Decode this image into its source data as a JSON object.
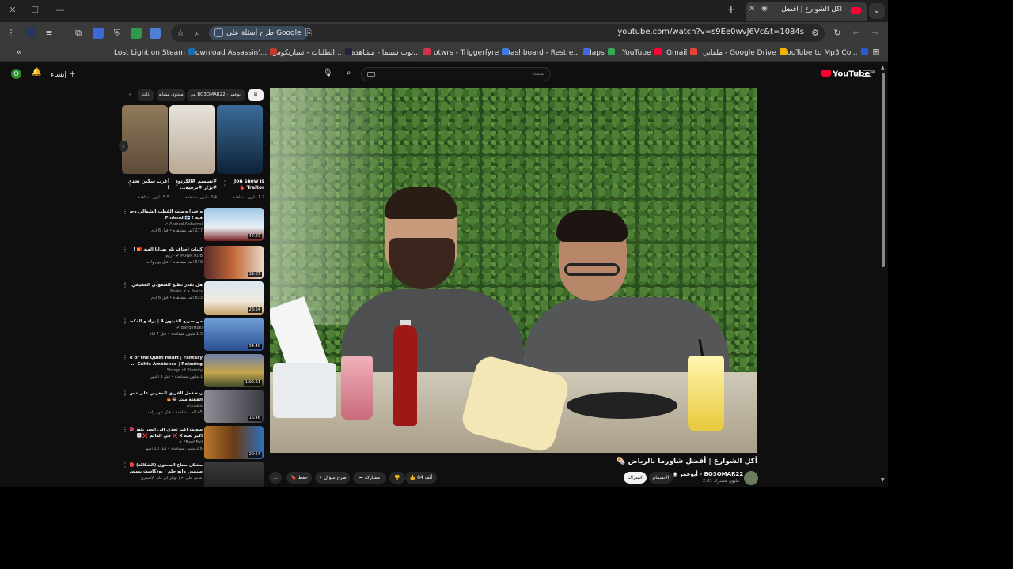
{
  "browser": {
    "tab_title": "أكل الشوارع | أفضل شاورما بالرياض",
    "new_tab_symbol": "+",
    "close_symbol": "✕",
    "url": "youtube.com/watch?v=s9Ee0wvJ6Vc&t=1084s",
    "ask_google": "طرح أسئلة على Google",
    "bookmarks": [
      "ملفاتي - Google Drive",
      "Gmail",
      "YouTube",
      "Maps",
      "Dashboard - Restre...",
      "otwrs - Triggerfyre",
      "توب سينما - مشاهدة...",
      "الطلبات - سيارتكوس...",
      "Download Assassin'...",
      "Lost Light on Steam"
    ],
    "bookmark_mp3": "YouTube to Mp3 Co..."
  },
  "youtube": {
    "logo": "YouTube",
    "logo_sup": "SA",
    "search_placeholder": "بحث",
    "create_label": "إنشاء",
    "avatar_letter": "O"
  },
  "video": {
    "title": "أكل الشوارع | أفضل شاورما بالرياض 🌯",
    "channel": "أبوعمر - BO3OMAR22",
    "subscribers": "2.81 مليون مشترك",
    "subscribe": "اشتراك",
    "join": "الانضمام",
    "likes": "84 ألف",
    "share": "مشاركة",
    "ask": "طرح سؤال",
    "save": "حفظ",
    "more": "..."
  },
  "sidebar": {
    "chips": [
      "من BO3OMAR22 - أبوعمر",
      "محتوى مشابه",
      "ذات",
      "الكل"
    ],
    "shorts": [
      {
        "title": "Jon snow is",
        "title2": "Traitor 🩸",
        "views": "1.2 مليون مشاهدة"
      },
      {
        "title": "#تسميم #الكرتون",
        "title2": "#برّاز #ترفيه...",
        "views": "3.4 مليون مشاهدة"
      },
      {
        "title": "أغرب سكين تحدي",
        "title2": "!",
        "views": "5.5 مليون مشاهدة"
      }
    ],
    "videos": [
      {
        "t": "وأخيرا وصلت القطب الشمالي وجربت اسبح",
        "t2": "فيه ! Finland 🇫🇮",
        "ch": "Ahmed Alshamsi ✔",
        "meta": "277 ألف مشاهدة • قبل 6 أيام",
        "dur": "47:27"
      },
      {
        "t": "كليات أحتاف بلو بهدايا العيد 🎁 !",
        "t2": "",
        "ch": "POWR ROB ✔ - ربيع",
        "meta": "579 ألف مشاهدة • قبل يوم واحد",
        "dur": "39:07"
      },
      {
        "t": "هل تقدر تطلع السعودي الحقيقي من بينهم؟ 🇸🇦",
        "t2": "",
        "ch": "Peaks ✔ • Peaks",
        "meta": "823 ألف مشاهدة • قبل 6 أيام",
        "dur": "28:54"
      },
      {
        "t": "من سريع الفيتون 4 | براء و المكسيكي 🔥",
        "t2": "",
        "ch": "Bandertoki ✔",
        "meta": "1.5 مليون مشاهدة • قبل 7 أيام",
        "dur": "54:40"
      },
      {
        "t": "Vale of the Quiet Heart | Fantasy",
        "t2": "Celtic Ambience | Relaxing ...",
        "ch": "Strings of Eternity",
        "meta": "1 مليون مشاهدة • قبل 3 أشهر",
        "dur": "1:02:21"
      },
      {
        "t": "ردة فعل الفريق المغربي على دس الفيانات |",
        "t2": "القفلة مش 😂🔥",
        "ch": "simsake",
        "meta": "45 ألف مشاهدة • قبل شهر واحد",
        "dur": "16:46"
      },
      {
        "t": "سويت اكبر تحدي الى السر بلور 🌺 ❗🔥 !",
        "t2": "اكبر لعبة X ❌ في العالم ❌ 🅾",
        "ch": "FBeef Full ✔",
        "meta": "2.6 مليون مشاهدة • قبل 10 أشهر",
        "dur": "20:54"
      },
      {
        "t": "مشكل صناع المحتوى (الشكالة) 🔴 |",
        "t2": "سيمبي وأبو حلم | بودكاست بسس خير",
        "ch": "عدتي علي ✔ | تويلر أبو عائد الأشمري",
        "meta": "",
        "dur": ""
      }
    ]
  }
}
